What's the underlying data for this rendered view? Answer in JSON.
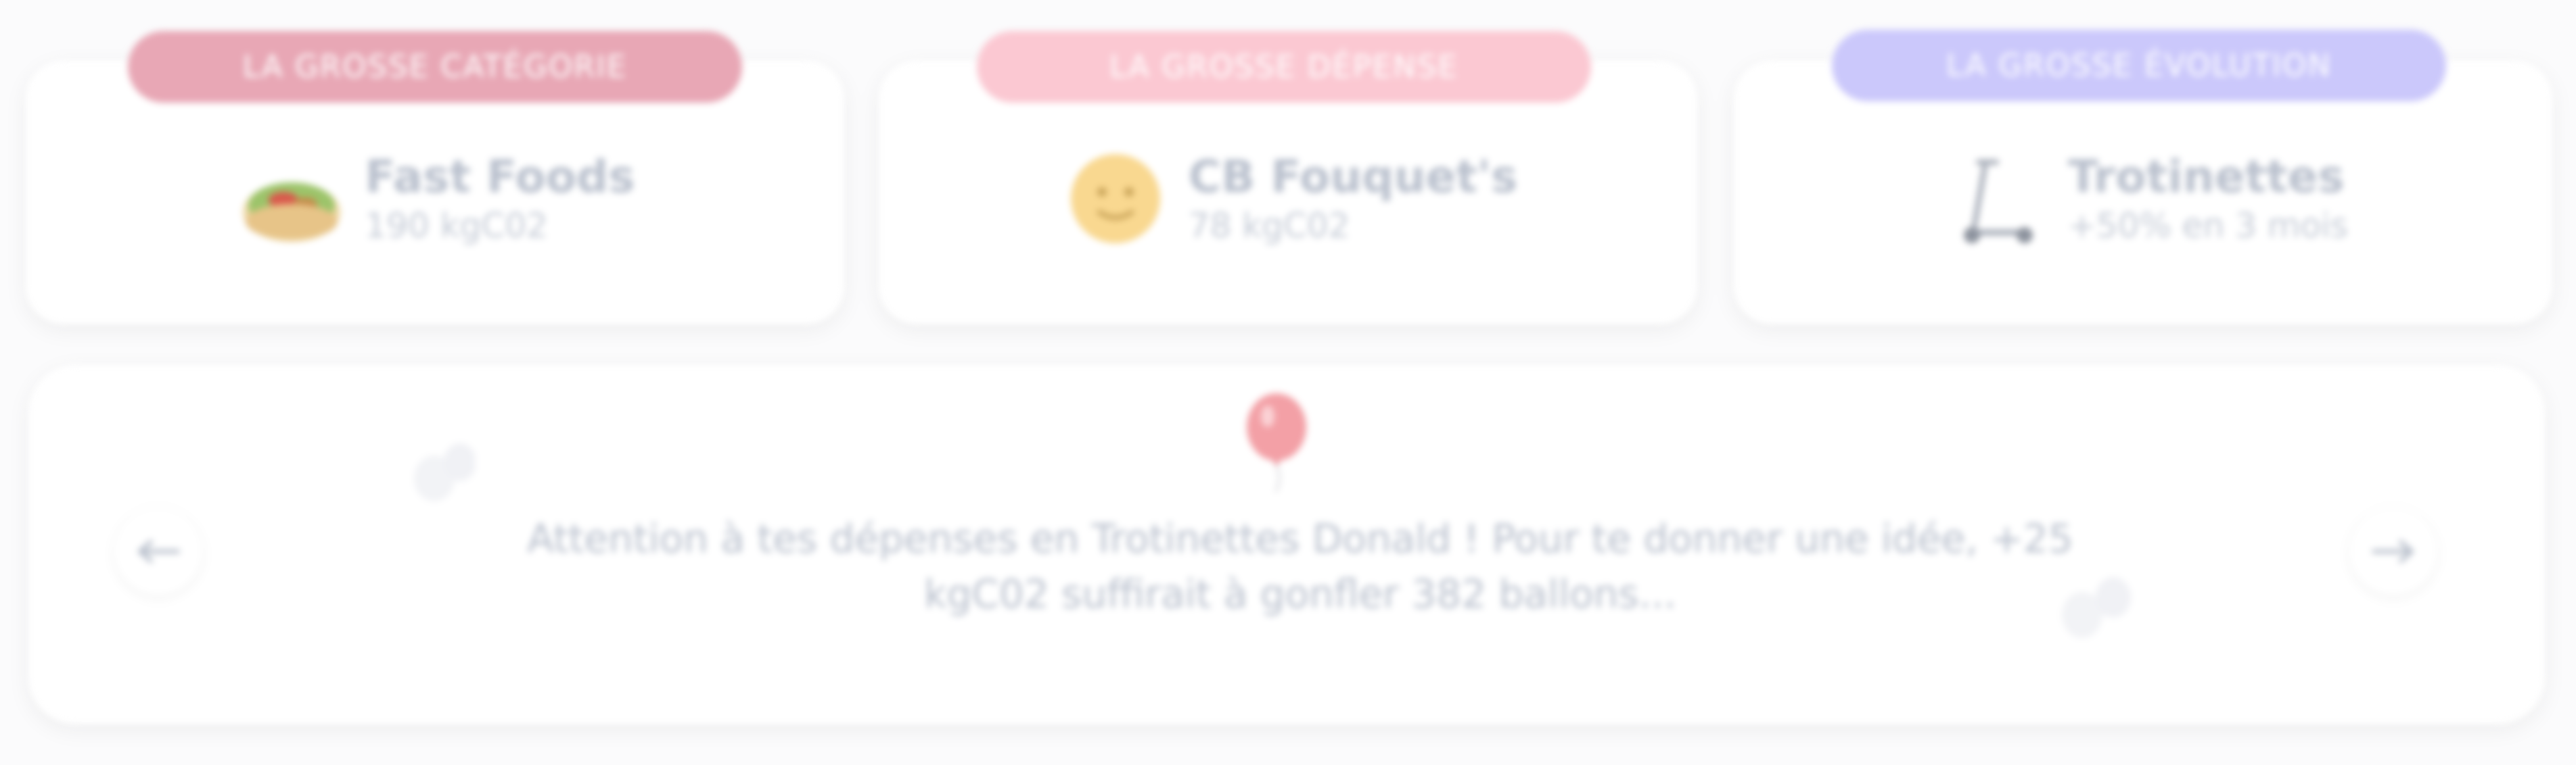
{
  "cards": [
    {
      "tag": "LA GROSSE CATÉGORIE",
      "title": "Fast Foods",
      "subtitle": "190 kgC02",
      "icon": "kebab-icon",
      "tag_color": "#e8a7b5"
    },
    {
      "tag": "LA GROSSE DÉPENSE",
      "title": "CB Fouquet's",
      "subtitle": "78 kgC02",
      "icon": "smiley-icon",
      "tag_color": "#fbc8d2"
    },
    {
      "tag": "LA GROSSE ÉVOLUTION",
      "title": "Trotinettes",
      "subtitle": "+50% en 3 mois",
      "icon": "scooter-icon",
      "tag_color": "#cbc8fb"
    }
  ],
  "insight": {
    "message": "Attention à tes dépenses en Trotinettes Donald ! Pour te donner une idée, +25 kgC02 suffirait à gonfler 382 ballons...",
    "prev_icon": "arrow-left-icon",
    "next_icon": "arrow-right-icon",
    "illustration_icon": "balloon-icon"
  }
}
